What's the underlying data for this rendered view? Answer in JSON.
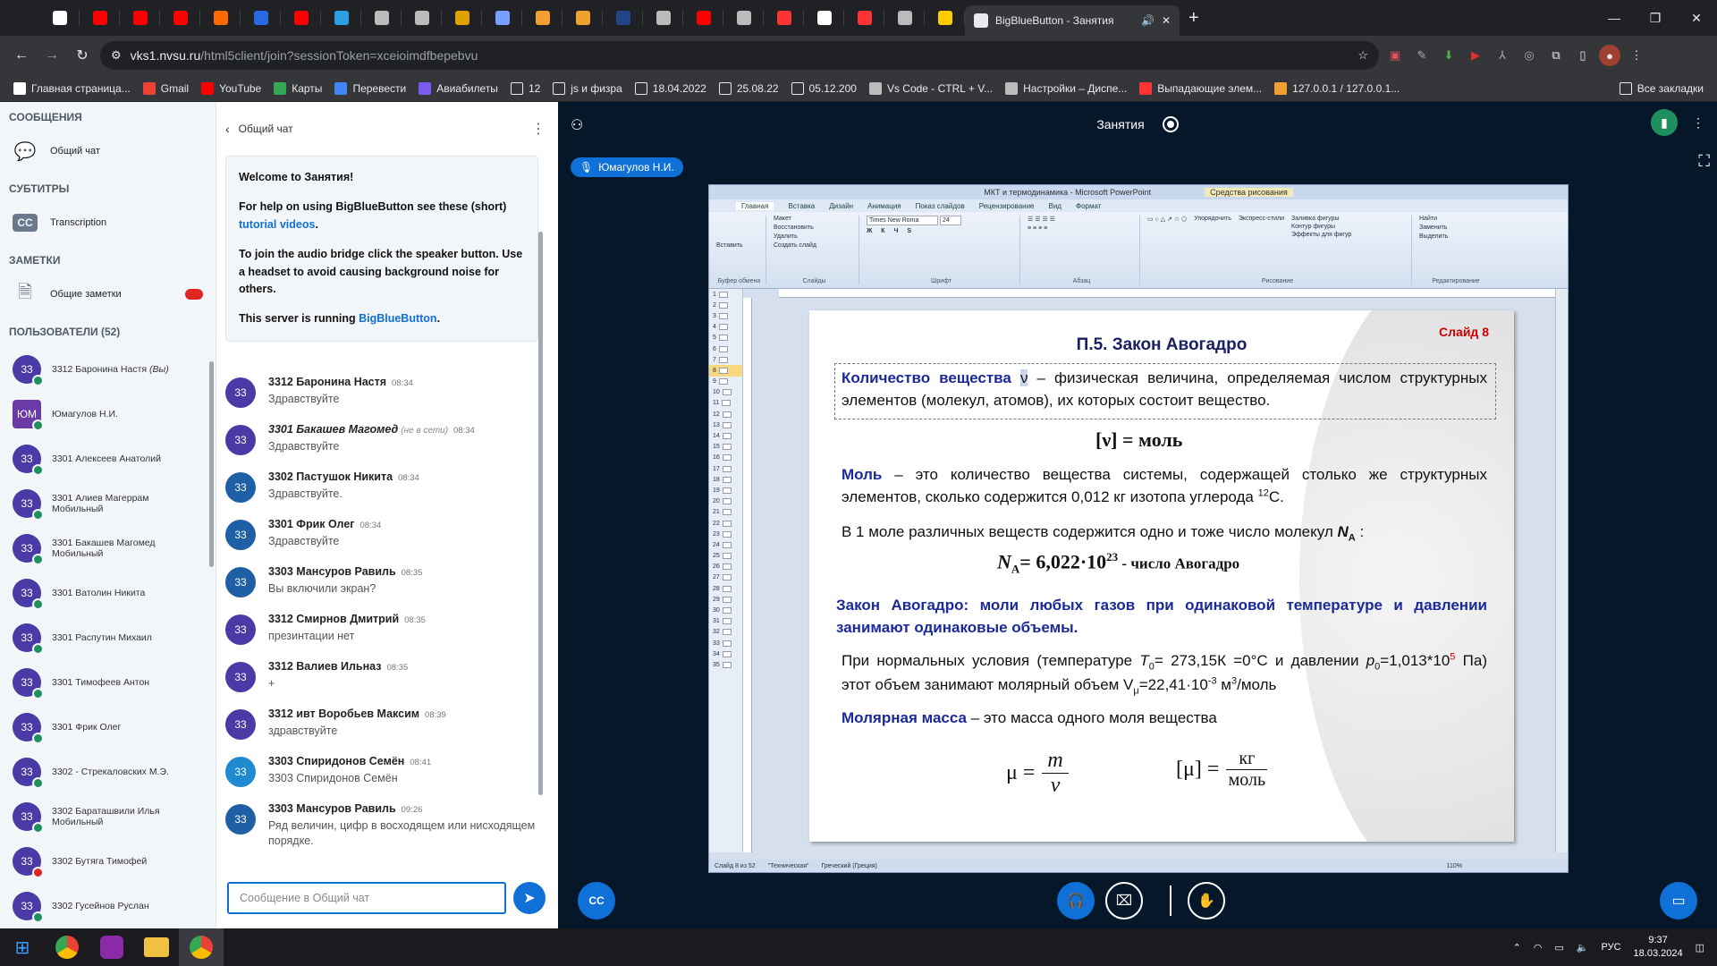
{
  "browser": {
    "active_tab_title": "BigBlueButton - Занятия",
    "url_host": "vks1.nvsu.ru",
    "url_path": "/html5client/join?sessionToken=xceioimdfbepebvu",
    "pinned_tabs": [
      {
        "icon": "chat-icon",
        "color": "#ffffff"
      },
      {
        "icon": "youtube-icon",
        "color": "#ff0000"
      },
      {
        "icon": "youtube-icon",
        "color": "#ff0000"
      },
      {
        "icon": "youtube-icon",
        "color": "#ff0000"
      },
      {
        "icon": "tinkercad-icon",
        "color": "#ff6a00"
      },
      {
        "icon": "play-icon",
        "color": "#2a6ae0"
      },
      {
        "icon": "youtube-icon",
        "color": "#ff0000"
      },
      {
        "icon": "office-icon",
        "color": "#2aa0e0"
      },
      {
        "icon": "image-icon",
        "color": "#bbbbbb"
      },
      {
        "icon": "globe-icon",
        "color": "#bbbbbb"
      },
      {
        "icon": "tool-icon",
        "color": "#e0a000"
      },
      {
        "icon": "atom-icon",
        "color": "#7aa0ff"
      },
      {
        "icon": "sheet-icon",
        "color": "#f0a030"
      },
      {
        "icon": "sheet-icon",
        "color": "#f0a030"
      },
      {
        "icon": "dark-icon",
        "color": "#224488"
      },
      {
        "icon": "globe-icon",
        "color": "#bbbbbb"
      },
      {
        "icon": "youtube-icon",
        "color": "#ff0000"
      },
      {
        "icon": "globe-icon",
        "color": "#bbbbbb"
      },
      {
        "icon": "yandex-icon",
        "color": "#ff3333"
      },
      {
        "icon": "star-icon",
        "color": "#ffffff"
      },
      {
        "icon": "yandex-icon",
        "color": "#ff3333"
      },
      {
        "icon": "globe-icon",
        "color": "#bbbbbb"
      },
      {
        "icon": "sun-icon",
        "color": "#ffcc00"
      }
    ],
    "bookmarks": [
      {
        "label": "Главная страница...",
        "icon": "star-icon",
        "color": "#ffffff"
      },
      {
        "label": "Gmail",
        "icon": "gmail-icon",
        "color": "#ea4335"
      },
      {
        "label": "YouTube",
        "icon": "youtube-icon",
        "color": "#ff0000"
      },
      {
        "label": "Карты",
        "icon": "maps-icon",
        "color": "#34a853"
      },
      {
        "label": "Перевести",
        "icon": "translate-icon",
        "color": "#4285f4"
      },
      {
        "label": "Авиабилеты",
        "icon": "plane-icon",
        "color": "#7a5af0"
      },
      {
        "label": "12",
        "icon": "folder-icon",
        "color": "#e8eaed"
      },
      {
        "label": "js и физра",
        "icon": "folder-icon",
        "color": "#e8eaed"
      },
      {
        "label": "18.04.2022",
        "icon": "folder-icon",
        "color": "#e8eaed"
      },
      {
        "label": "25.08.22",
        "icon": "folder-icon",
        "color": "#e8eaed"
      },
      {
        "label": "05.12.200",
        "icon": "folder-icon",
        "color": "#e8eaed"
      },
      {
        "label": "Vs Code - CTRL + V...",
        "icon": "vscode-icon",
        "color": "#bbbbbb"
      },
      {
        "label": "Настройки – Диспе...",
        "icon": "gear-icon",
        "color": "#bbbbbb"
      },
      {
        "label": "Выпадающие элем...",
        "icon": "yandex-icon",
        "color": "#ff3333"
      },
      {
        "label": "127.0.0.1 / 127.0.0.1...",
        "icon": "pma-icon",
        "color": "#f0a030"
      }
    ],
    "all_bookmarks": "Все закладки"
  },
  "sidebar": {
    "messages_header": "СООБЩЕНИЯ",
    "public_chat": "Общий чат",
    "subtitles_header": "СУБТИТРЫ",
    "transcription": "Transcription",
    "notes_header": "ЗАМЕТКИ",
    "shared_notes": "Общие заметки",
    "users_header": "ПОЛЬЗОВАТЕЛИ (52)",
    "users": [
      {
        "initials": "33",
        "name": "3312 Баронина Настя",
        "suffix": " (Вы)",
        "status": "green",
        "lines": 1
      },
      {
        "initials": "ЮМ",
        "name": "Юмагулов Н.И.",
        "suffix": "",
        "status": "green",
        "lines": 1,
        "square": true
      },
      {
        "initials": "33",
        "name": "3301 Алексеев Анатолий",
        "suffix": "",
        "status": "green",
        "lines": 1
      },
      {
        "initials": "33",
        "name": "3301 Алиев Магеррам",
        "line2": "Мобильный",
        "suffix": "",
        "status": "green"
      },
      {
        "initials": "33",
        "name": "3301 Бакашев Магомед",
        "line2": "Мобильный",
        "suffix": "",
        "status": "green"
      },
      {
        "initials": "33",
        "name": "3301 Ватолин Никита",
        "suffix": "",
        "status": "green"
      },
      {
        "initials": "33",
        "name": "3301 Распутин Михаил",
        "suffix": "",
        "status": "green"
      },
      {
        "initials": "33",
        "name": "3301 Тимофеев Антон",
        "suffix": "",
        "status": "green"
      },
      {
        "initials": "33",
        "name": "3301 Фрик Олег",
        "suffix": "",
        "status": "green"
      },
      {
        "initials": "33",
        "name": "3302 - Стрекаловских М.Э.",
        "suffix": "",
        "status": "green"
      },
      {
        "initials": "33",
        "name": "3302 Бараташвили Илья",
        "line2": "Мобильный",
        "suffix": "",
        "status": "green"
      },
      {
        "initials": "33",
        "name": "3302 Бутяга Тимофей",
        "suffix": "",
        "status": "red"
      },
      {
        "initials": "33",
        "name": "3302 Гусейнов Руслан",
        "suffix": "",
        "status": "green"
      }
    ]
  },
  "chat": {
    "title": "Общий чат",
    "welcome_prefix": "Welcome to ",
    "welcome_room": "Занятия",
    "welcome_suffix": "!",
    "help_text": "For help on using BigBlueButton see these (short) ",
    "help_link": "tutorial videos",
    "help_end": ".",
    "audio_text": "To join the audio bridge click the speaker button. Use a headset to avoid causing background noise for others.",
    "server_text": "This server is running ",
    "server_link": "BigBlueButton",
    "server_end": ".",
    "messages": [
      {
        "name": "3312 Баронина Настя",
        "time": "08:34",
        "text": "Здравствуйте",
        "color": "#4a3aa6"
      },
      {
        "name": "3301 Бакашев Магомед",
        "offline": "(не в сети)",
        "time": "08:34",
        "text": "Здравствуйте",
        "color": "#4a3aa6",
        "italic": true
      },
      {
        "name": "3302 Пастушок Никита",
        "time": "08:34",
        "text": "Здравствуйте.",
        "color": "#1f5fa6"
      },
      {
        "name": "3301 Фрик Олег",
        "time": "08:34",
        "text": "Здравствуйте",
        "color": "#1f5fa6"
      },
      {
        "name": "3303 Мансуров Равиль",
        "time": "08:35",
        "text": "Вы включили экран?",
        "color": "#1f5fa6"
      },
      {
        "name": "3312 Смирнов Дмитрий",
        "time": "08:35",
        "text": "презинтации нет",
        "color": "#4a3aa6"
      },
      {
        "name": "3312 Валиев Ильназ",
        "time": "08:35",
        "text": "+",
        "color": "#4a3aa6"
      },
      {
        "name": "3312 ивт Воробьев Максим",
        "time": "08:39",
        "text": "здравствуйте",
        "color": "#4a3aa6"
      },
      {
        "name": "3303 Спиридонов Семён",
        "time": "08:41",
        "text": "3303 Спиридонов Семён",
        "color": "#1f8ad0"
      },
      {
        "name": "3303 Мансуров Равиль",
        "time": "09:26",
        "text": "Ряд величин, цифр в восходящем или нисходящем порядке.",
        "color": "#1f5fa6"
      }
    ],
    "input_placeholder": "Сообщение в Общий чат"
  },
  "stage": {
    "room_title": "Занятия",
    "talker": "Юмагулов Н.И."
  },
  "ppt": {
    "window_title": "МКТ и термодинамика - Microsoft PowerPoint",
    "context_tab": "Средства рисования",
    "tabs": [
      "Главная",
      "Вставка",
      "Дизайн",
      "Анимация",
      "Показ слайдов",
      "Рецензирование",
      "Вид",
      "Формат"
    ],
    "font_name": "Times New Roma",
    "font_size": "24",
    "groups": [
      "Буфер обмена",
      "Слайды",
      "Шрифт",
      "Абзац",
      "Рисование",
      "Редактирование"
    ],
    "btn_paste": "Вставить",
    "btn_create": "Создать слайд",
    "btn_layout": "Макет",
    "btn_restore": "Восстановить",
    "btn_delete": "Удалить",
    "btn_arrange": "Упорядочить",
    "btn_styles": "Экспресс-стили",
    "btn_fill": "Заливка фигуры",
    "btn_outline": "Контур фигуры",
    "btn_effects": "Эффекты для фигур",
    "btn_find": "Найти",
    "btn_replace": "Заменить",
    "btn_select": "Выделить",
    "status_slide": "Слайд 8 из 52",
    "status_theme": "\"Техническая\"",
    "status_lang": "Греческий (Греция)",
    "zoom": "110%"
  },
  "slide": {
    "number": "Слайд 8",
    "title": "П.5. Закон Авогадро",
    "p1_key": "Количество вещества",
    "p1_sym": "ν",
    "p1_text": " – физическая величина, определяемая числом структурных элементов (молекул, атомов), их которых состоит вещество.",
    "f1": "[ν] = моль",
    "p2_key": "Моль",
    "p2_text": " – это количество вещества системы, содержащей столько же структурных элементов, сколько содержится 0,012 кг изотопа углерода ",
    "p2_sup": "12",
    "p2_end": "С.",
    "p3": "В 1 моле различных веществ содержится одно и тоже число молекул ",
    "p3_na": "N",
    "p3_sub": "A",
    "p3_end": " :",
    "f2_a": "N",
    "f2_sub": "A",
    "f2_b": "= 6,022·10",
    "f2_sup": "23",
    "f2_note": "  - число Авогадро",
    "p4_key": "Закон Авогадро:",
    "p4_text": "  моли любых газов при одинаковой температуре и давлении занимают одинаковые объемы.",
    "p5_a": "При нормальных условия (температуре ",
    "p5_T": "T",
    "p5_0": "0",
    "p5_b": "= 273,15К =0°С и давлении ",
    "p5_p": "p",
    "p5_c": "=1,013*10",
    "p5_5": "5",
    "p5_d": " Па) этот объем занимают молярный объем V",
    "p5_mu": "μ",
    "p5_e": "=22,41·10",
    "p5_m3": "-3",
    "p5_f": " м",
    "p5_3": "3",
    "p5_g": "/моль",
    "p6_key": "Молярная масса",
    "p6_text": " – это масса одного моля вещества",
    "f3_mu": "μ =",
    "f3_num": "m",
    "f3_den": "ν",
    "f4_mu": "[μ] =",
    "f4_num": "кг",
    "f4_den": "моль"
  },
  "taskbar": {
    "lang": "РУС",
    "time": "9:37",
    "date": "18.03.2024"
  }
}
